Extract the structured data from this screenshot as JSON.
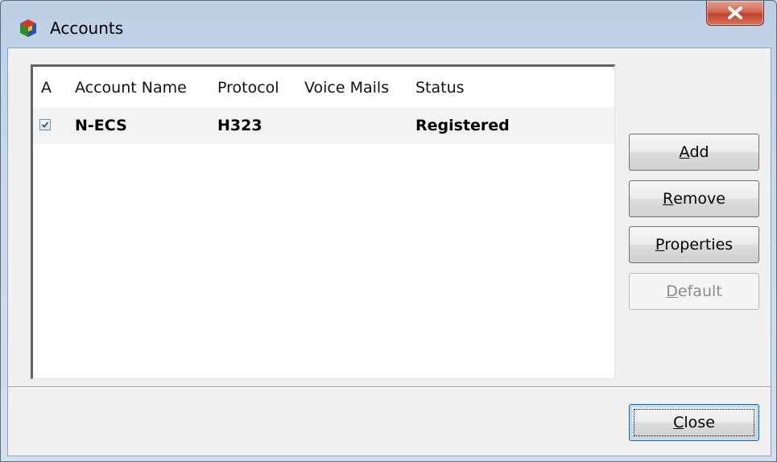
{
  "window": {
    "title": "Accounts"
  },
  "list": {
    "columns": [
      "A",
      "Account Name",
      "Protocol",
      "Voice Mails",
      "Status"
    ],
    "rows": [
      {
        "active": true,
        "account_name": "N-ECS",
        "protocol": "H323",
        "voice_mails": "",
        "status": "Registered"
      }
    ]
  },
  "buttons": {
    "add": {
      "access": "A",
      "rest": "dd"
    },
    "remove": {
      "access": "R",
      "rest": "emove"
    },
    "properties": {
      "access": "P",
      "rest": "roperties"
    },
    "default": {
      "access": "D",
      "rest": "efault"
    },
    "close": {
      "access": "C",
      "rest": "lose"
    }
  },
  "colors": {
    "close_button_red": "#c2402a",
    "window_frame": "#c9d9eb",
    "dialog_bg": "#f0f0f0"
  },
  "icons": {
    "app": "cube-app-icon",
    "close": "close-icon",
    "checkbox": "checkbox-checked-icon"
  }
}
